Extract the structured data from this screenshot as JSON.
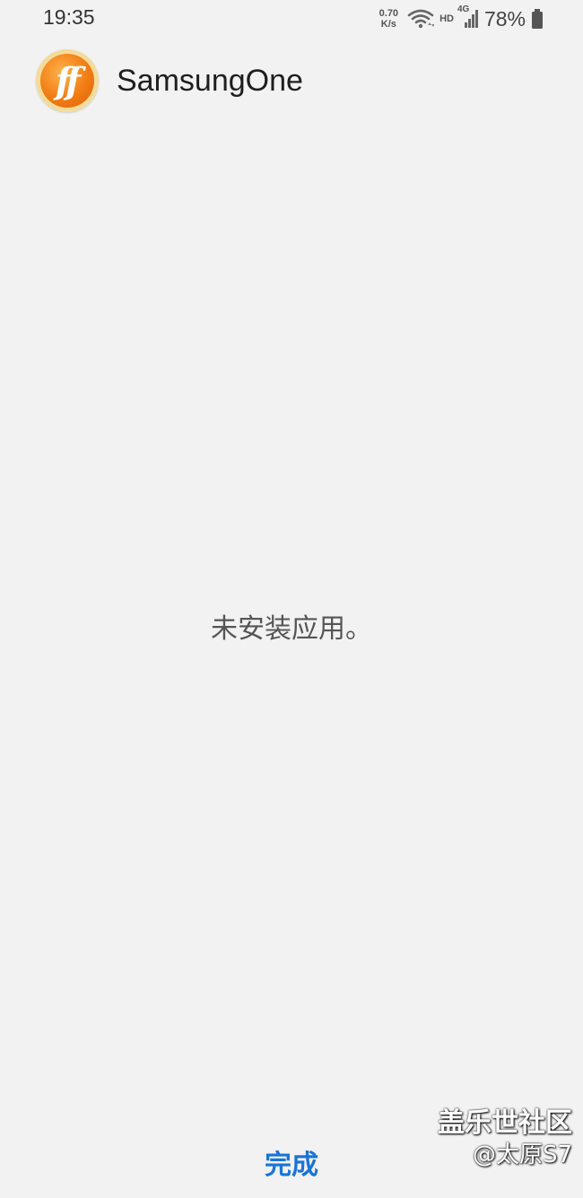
{
  "status_bar": {
    "time": "19:35",
    "net_speed_value": "0.70",
    "net_speed_unit": "K/s",
    "hd_label": "HD",
    "network_type": "4G",
    "battery_percent": "78%",
    "icons": [
      "wifi-icon",
      "signal-icon",
      "battery-icon"
    ]
  },
  "header": {
    "app_name": "SamsungOne",
    "app_icon_text": "ff"
  },
  "main": {
    "message": "未安装应用。"
  },
  "footer": {
    "done_label": "完成"
  },
  "watermark": {
    "line1": "盖乐世社区",
    "line2": "@太原S7"
  },
  "colors": {
    "background": "#f2f2f2",
    "accent": "#1a73d9",
    "icon_orange": "#f17c14",
    "icon_ring": "#f3dc9a"
  }
}
